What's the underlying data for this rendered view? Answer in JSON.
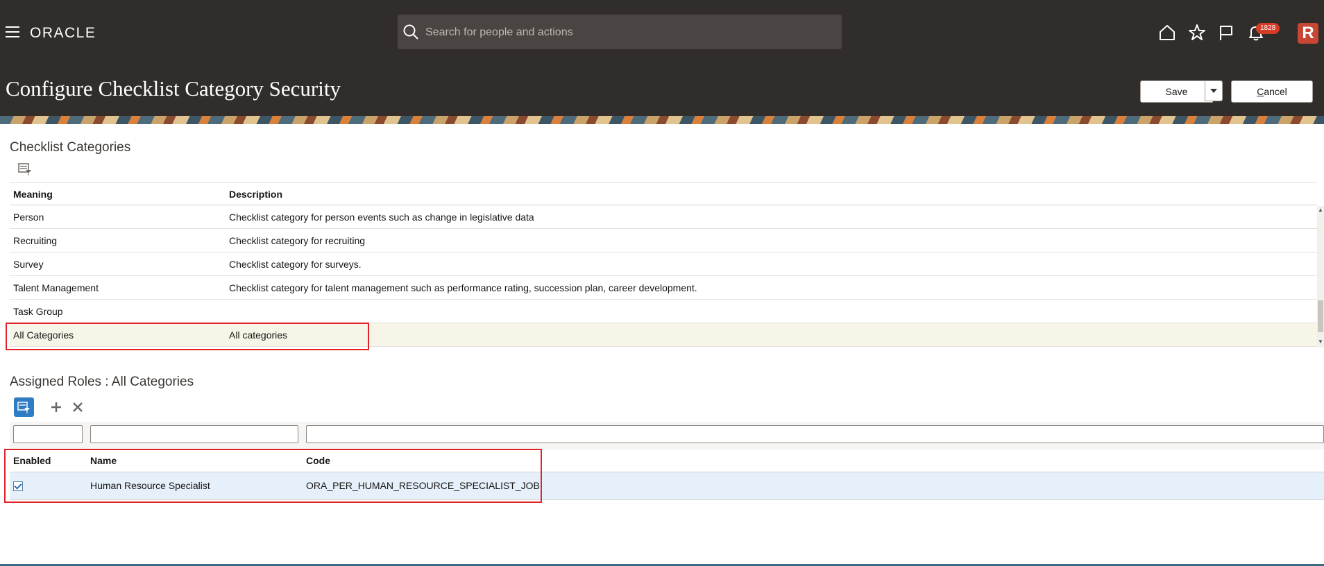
{
  "header": {
    "logo": "ORACLE",
    "search_placeholder": "Search for people and actions",
    "notification_count": "1828",
    "avatar_letter": "R"
  },
  "page": {
    "title": "Configure Checklist Category Security",
    "save_label": "Save",
    "cancel_label": "ancel",
    "cancel_mnemonic": "C"
  },
  "categories": {
    "title": "Checklist Categories",
    "columns": [
      "Meaning",
      "Description"
    ],
    "rows": [
      {
        "meaning": "Person",
        "description": "Checklist category for person events such as change in legislative data"
      },
      {
        "meaning": "Recruiting",
        "description": "Checklist category for recruiting"
      },
      {
        "meaning": "Survey",
        "description": "Checklist category for surveys."
      },
      {
        "meaning": "Talent Management",
        "description": "Checklist category for talent management such as performance rating, succession plan, career development."
      },
      {
        "meaning": "Task Group",
        "description": ""
      },
      {
        "meaning": "All Categories",
        "description": "All categories"
      }
    ],
    "selected_index": 5
  },
  "roles": {
    "title": "Assigned Roles : All Categories",
    "columns": [
      "Enabled",
      "Name",
      "Code"
    ],
    "rows": [
      {
        "enabled": true,
        "name": "Human Resource Specialist",
        "code": "ORA_PER_HUMAN_RESOURCE_SPECIALIST_JOB"
      }
    ]
  },
  "icons": {
    "menu": "hamburger-icon",
    "home": "home-icon",
    "favorites": "star-icon",
    "flag": "flag-icon",
    "notifications": "bell-icon",
    "query": "query-by-example-icon",
    "add": "plus-icon",
    "delete": "x-icon"
  },
  "colors": {
    "header_bg": "#312d2a",
    "highlight_border": "#e2232a",
    "selected_row": "#f7f5e8",
    "role_row": "#e6f0fa",
    "badge": "#d63b25"
  }
}
